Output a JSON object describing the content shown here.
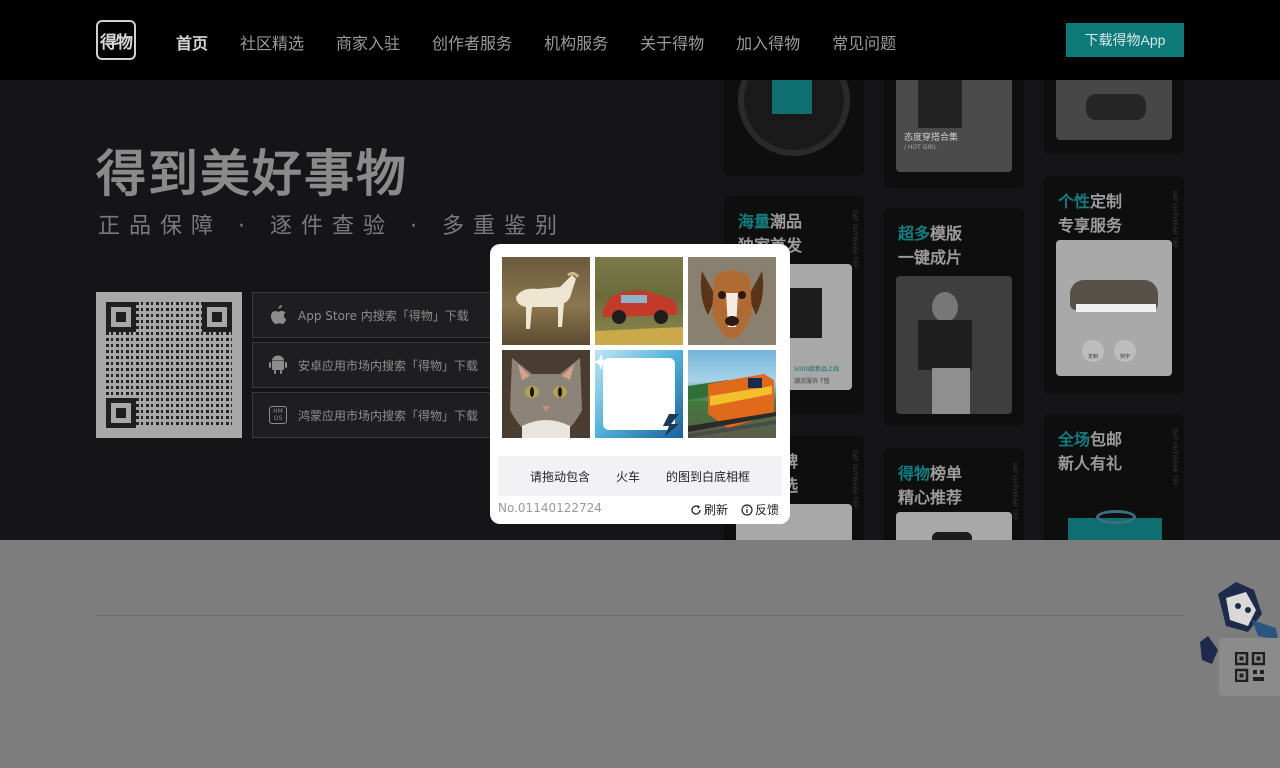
{
  "nav": {
    "logo_text": "得物",
    "links": [
      "首页",
      "社区精选",
      "商家入驻",
      "创作者服务",
      "机构服务",
      "关于得物",
      "加入得物",
      "常见问题"
    ],
    "download_button": "下载得物App"
  },
  "hero": {
    "title": "得到美好事物",
    "subtitle": "正品保障 · 逐件查验 · 多重鉴别",
    "store_buttons": [
      {
        "icon": "apple-icon",
        "label": "App Store 内搜索「得物」下载"
      },
      {
        "icon": "android-icon",
        "label": "安卓应用市场内搜索「得物」下载"
      },
      {
        "icon": "harmonyos-icon",
        "label": "鸿蒙应用市场内搜索「得物」下载"
      }
    ],
    "harmony_icon_text": "HM OS"
  },
  "cards": {
    "card_a": {
      "caption": "态度穿搭合集",
      "caption_en": "/ HOT GIRL"
    },
    "card_b": {
      "hl": "海量",
      "rest": "潮品",
      "line2": "独家首发",
      "badge1": "5000款新品上线",
      "badge2": "潮流服饰 T恤"
    },
    "card_c": {
      "hl": "超多",
      "rest": "模版",
      "line2": "一键成片"
    },
    "card_d": {
      "hl": "个性",
      "rest": "定制",
      "line2": "专享服务",
      "btn1": "定制",
      "btn2": "刻字"
    },
    "card_e": {
      "line1": "牌",
      "line2": "选"
    },
    "card_f": {
      "hl": "得物",
      "rest": "榜单",
      "line2": "精心推荐"
    },
    "card_g": {
      "hl": "全场",
      "rest": "包邮",
      "line2": "新人有礼"
    },
    "tag_text": "DAT OUTWEAR TRP"
  },
  "captcha": {
    "prompt_parts": [
      "请拖动包含",
      "火车",
      "的图到白底相框"
    ],
    "id": "No.01140122724",
    "refresh": "刷新",
    "feedback": "反馈",
    "tiles": [
      "horse",
      "car",
      "dog",
      "cat",
      "white-frame",
      "train"
    ]
  }
}
